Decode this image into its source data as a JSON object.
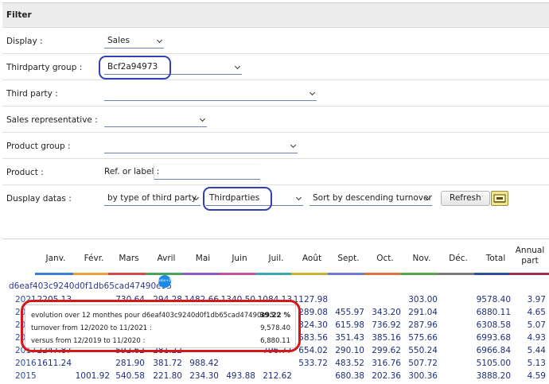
{
  "filter": {
    "title": "Filter",
    "display": {
      "label": "Display :",
      "value": "Sales"
    },
    "thirdparty_group": {
      "label": "Thirdparty group :",
      "value": "Bcf2a94973"
    },
    "third_party": {
      "label": "Third party :",
      "value": ""
    },
    "sales_rep": {
      "label": "Sales representative :",
      "value": ""
    },
    "product_group": {
      "label": "Product group :",
      "value": ""
    },
    "product": {
      "label": "Product :",
      "ref_label": "Ref. or label :",
      "value": ""
    },
    "display_datas": {
      "label": "Dusplay datas :",
      "by_type": "by type of third party",
      "thirdparties": "Thirdparties",
      "sort": "Sort by descending turnover",
      "refresh": "Refresh"
    }
  },
  "table": {
    "headers": [
      "Janv.",
      "Févr.",
      "Mars",
      "Avril",
      "Mai",
      "Juin",
      "Juil.",
      "Août",
      "Sept.",
      "Oct.",
      "Nov.",
      "Déc.",
      "Total"
    ],
    "annual_header_line1": "Annual",
    "annual_header_line2": "part",
    "header_colors": [
      "#3c7fd6",
      "#e8a33b",
      "#d24a4a",
      "#4aa35a",
      "#8a5bc7",
      "#c84f9a",
      "#3aa9b0",
      "#c9b22f",
      "#6f7ad4",
      "#e0733d",
      "#56a646",
      "#7a7a7a",
      "#2f4f9e",
      "#9e2f4f"
    ],
    "group_name": "d6eaf403c9240d0f1db65cad47490e95",
    "group_icon_text": "jobs+13%",
    "rows": [
      {
        "year": "2021",
        "cells": [
          "2205.13",
          "",
          "730.64",
          "294.28",
          "1482.66",
          "1340.50",
          "1084.13",
          "1127.98",
          "",
          "",
          "303.00",
          "",
          "9578.40",
          "3.97"
        ]
      },
      {
        "year": "2020",
        "cells": [
          "",
          "",
          "",
          "",
          "",
          "",
          "",
          "289.08",
          "455.97",
          "343.20",
          "291.04",
          "",
          "6880.11",
          "4.65"
        ]
      },
      {
        "year": "2019",
        "cells": [
          "",
          "",
          "",
          "",
          "",
          "",
          "",
          "324.30",
          "615.98",
          "736.92",
          "287.96",
          "",
          "6308.58",
          "5.07"
        ]
      },
      {
        "year": "2018",
        "cells": [
          "",
          "",
          "",
          "",
          "",
          "",
          "",
          "583.56",
          "351.43",
          "385.16",
          "575.66",
          "",
          "6993.68",
          "4.93"
        ]
      },
      {
        "year": "2017",
        "cells": [
          "2247.87",
          "",
          "592.62",
          "281.22",
          "",
          "",
          "796.77",
          "654.02",
          "290.10",
          "299.62",
          "550.24",
          "",
          "6966.84",
          "5.44"
        ]
      },
      {
        "year": "2016",
        "cells": [
          "1611.24",
          "",
          "281.90",
          "381.72",
          "988.42",
          "",
          "",
          "533.72",
          "483.52",
          "316.76",
          "507.72",
          "",
          "5105.00",
          "5.13"
        ]
      },
      {
        "year": "2015",
        "cells": [
          "",
          "1001.92",
          "540.58",
          "221.80",
          "234.30",
          "493.88",
          "212.62",
          "",
          "680.38",
          "202.36",
          "300.36",
          "",
          "3888.20",
          "4.59"
        ]
      }
    ]
  },
  "tooltip": {
    "line1_label": "evolution over 12 monthes pour d6eaf403c9240d0f1db65cad47490e95 :",
    "line1_value": "39.22 %",
    "line2_label": "turnover from 12/2020 to 11/2021 :",
    "line2_value": "9,578.40",
    "line3_label": "versus from 12/2019 to 11/2020 :",
    "line3_value": "6,880.11"
  }
}
